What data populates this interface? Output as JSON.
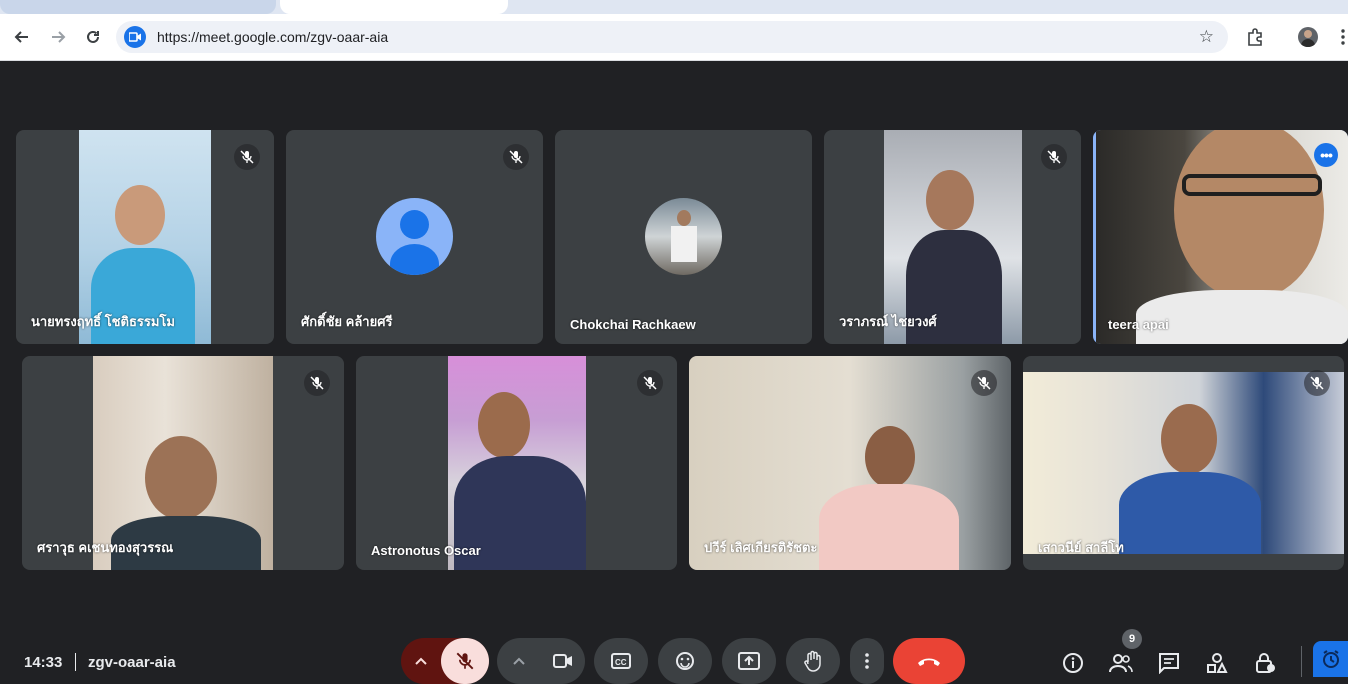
{
  "browser": {
    "url": "https://meet.google.com/zgv-oaar-aia"
  },
  "participants": [
    {
      "name": "นายทรงฤทธิ์ โชติธรรมโม",
      "muted": true
    },
    {
      "name": "ศักดิ์ชัย คล้ายศรี",
      "muted": true
    },
    {
      "name": "Chokchai Rachkaew",
      "muted": false
    },
    {
      "name": "วราภรณ์ ไชยวงศ์",
      "muted": true
    },
    {
      "name": "teera apai",
      "muted": false,
      "selected": true
    },
    {
      "name": "ศราวุธ คเชนทองสุวรรณ",
      "muted": true
    },
    {
      "name": "Astronotus Oscar",
      "muted": true
    },
    {
      "name": "ปวีร์ เลิศเกียรติรัชตะ",
      "muted": true
    },
    {
      "name": "เสาวนีย์ สาลีโท",
      "muted": true
    }
  ],
  "meeting": {
    "time": "14:33",
    "code": "zgv-oaar-aia",
    "participant_count": "9"
  },
  "colors": {
    "background": "#202124",
    "tile": "#3c4043",
    "end_call": "#ea4335",
    "mic_off": "#f9dedc",
    "accent": "#1a73e8"
  }
}
